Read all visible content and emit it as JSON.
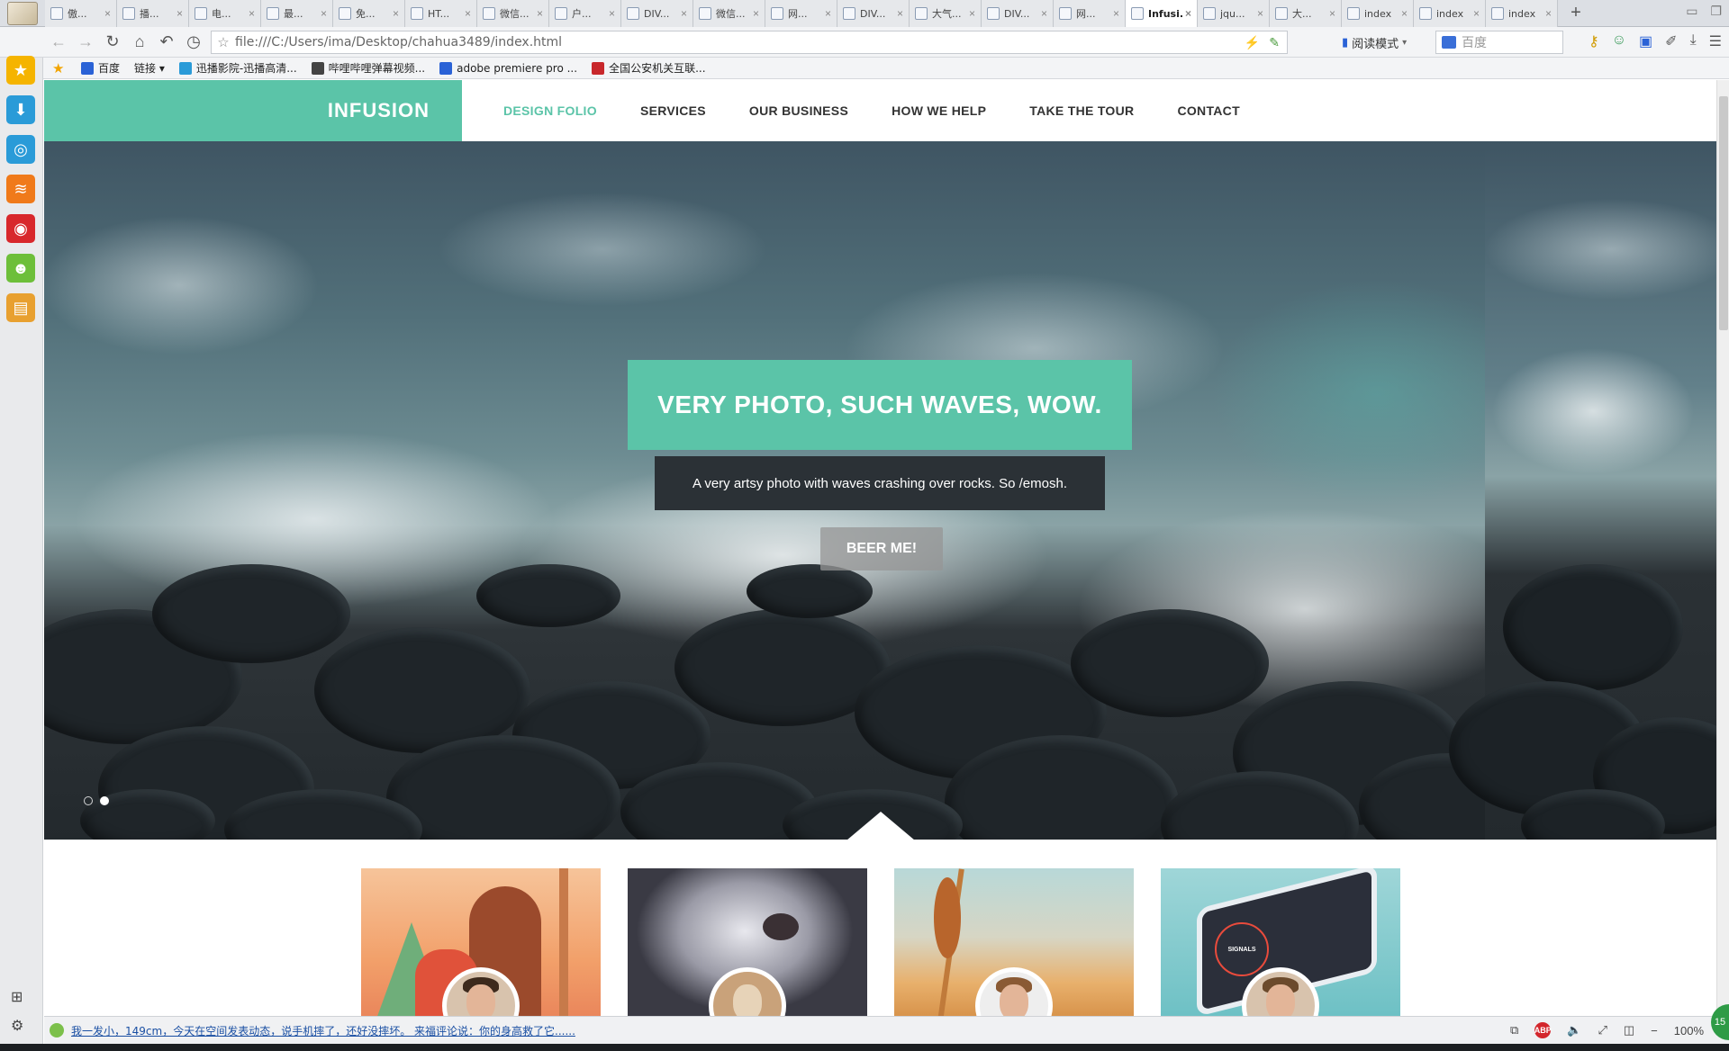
{
  "browser": {
    "tabs": [
      {
        "label": "傲..."
      },
      {
        "label": "播..."
      },
      {
        "label": "电..."
      },
      {
        "label": "最..."
      },
      {
        "label": "免..."
      },
      {
        "label": "HT..."
      },
      {
        "label": "微信..."
      },
      {
        "label": "户..."
      },
      {
        "label": "DIV..."
      },
      {
        "label": "微信..."
      },
      {
        "label": "网..."
      },
      {
        "label": "DIV..."
      },
      {
        "label": "大气..."
      },
      {
        "label": "DIV..."
      },
      {
        "label": "网..."
      },
      {
        "label": "Infusi..."
      },
      {
        "label": "jqu..."
      },
      {
        "label": "大..."
      },
      {
        "label": "index"
      },
      {
        "label": "index"
      },
      {
        "label": "index"
      }
    ],
    "active_tab_index": 15,
    "url": "file:///C:/Users/ima/Desktop/chahua3489/index.html",
    "read_mode_label": "阅读模式",
    "search_placeholder": "百度",
    "bookmarks": [
      {
        "label": "百度",
        "color": "#2a62d6"
      },
      {
        "label": "链接 ▾",
        "color": ""
      },
      {
        "label": "迅播影院-迅播高清...",
        "color": "#2a9bd8"
      },
      {
        "label": "哔哩哔哩弹幕视频...",
        "color": "#444444"
      },
      {
        "label": "adobe premiere pro ...",
        "color": "#2a62d6"
      },
      {
        "label": "全国公安机关互联...",
        "color": "#c8282c"
      }
    ],
    "status_news": "我一发小，149cm，今天在空间发表动态，说手机摔了，还好没摔坏。 来福评论说：你的身高救了它......",
    "zoom": "100%",
    "side_badge": "15"
  },
  "site": {
    "brand": "INFUSION",
    "nav": [
      {
        "label": "DESIGN FOLIO",
        "active": true
      },
      {
        "label": "SERVICES",
        "active": false
      },
      {
        "label": "OUR BUSINESS",
        "active": false
      },
      {
        "label": "HOW WE HELP",
        "active": false
      },
      {
        "label": "TAKE THE TOUR",
        "active": false
      },
      {
        "label": "CONTACT",
        "active": false
      }
    ],
    "hero": {
      "title": "VERY PHOTO, SUCH WAVES, WOW.",
      "subtitle": "A very artsy photo with waves crashing over rocks. So /emosh.",
      "cta": "BEER ME!",
      "slides": 2,
      "active_slide": 2
    },
    "accent_color": "#5bc4a8",
    "team_cards": [
      {
        "art": "illustration-cat-and-bear",
        "avatar": "man-avatar"
      },
      {
        "art": "illustration-polar-bear",
        "avatar": "dog-avatar"
      },
      {
        "art": "photo-wheat-field",
        "avatar": "glasses-man-avatar"
      },
      {
        "art": "isometric-phone-signals",
        "avatar": "smiling-man-avatar"
      }
    ],
    "card4_text": "SIGNALS"
  }
}
